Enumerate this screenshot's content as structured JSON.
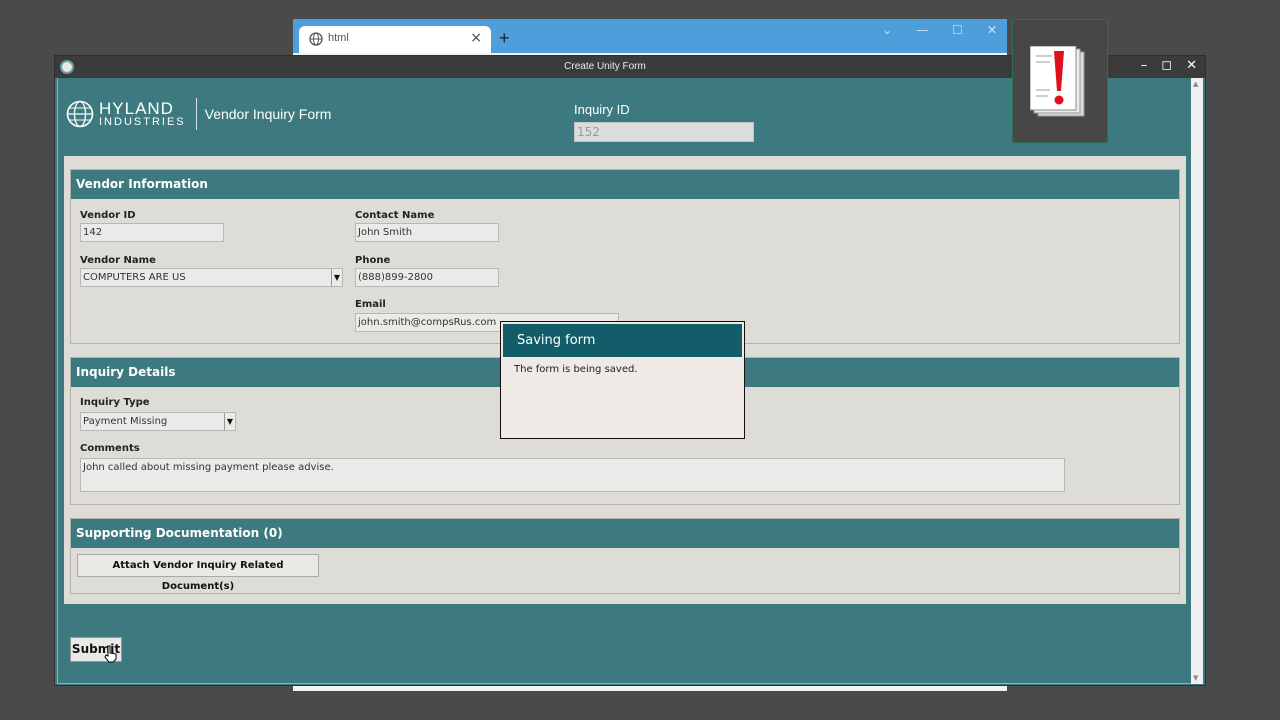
{
  "browser": {
    "tab_title": "html",
    "new_tab_label": "+",
    "close_tab_label": "×",
    "controls": [
      "⌄",
      "—",
      "☐",
      "✕"
    ]
  },
  "window": {
    "title": "Create Unity Form",
    "minimize": "–",
    "maximize": "◻",
    "close": "✕"
  },
  "header": {
    "logo_name": "HYLAND",
    "logo_sub": "INDUSTRIES",
    "form_title": "Vendor Inquiry Form",
    "inquiry_id_label": "Inquiry ID",
    "inquiry_id_value": "152"
  },
  "vendor_info": {
    "heading": "Vendor Information",
    "vendor_id_label": "Vendor ID",
    "vendor_id_value": "142",
    "vendor_name_label": "Vendor Name",
    "vendor_name_value": "COMPUTERS ARE US",
    "contact_name_label": "Contact Name",
    "contact_name_value": "John Smith",
    "phone_label": "Phone",
    "phone_value": "(888)899-2800",
    "email_label": "Email",
    "email_value": "john.smith@compsRus.com"
  },
  "inquiry_details": {
    "heading": "Inquiry Details",
    "type_label": "Inquiry Type",
    "type_value": "Payment Missing",
    "comments_label": "Comments",
    "comments_value": "John called about missing payment please advise."
  },
  "supporting_docs": {
    "heading": "Supporting Documentation (0)",
    "attach_label": "Attach Vendor Inquiry Related Document(s)"
  },
  "submit_label": "Submit",
  "modal": {
    "title": "Saving form",
    "message": "The form is being saved."
  },
  "icons": {
    "dropdown": "▼",
    "scroll_up": "▲",
    "scroll_down": "▼",
    "globe": "globe-icon",
    "alert_document": "alert-document-icon",
    "cursor": "pointer-cursor-icon"
  },
  "colors": {
    "accent_teal": "#3d7a80",
    "modal_header": "#135d6a",
    "browser_blue": "#4f9edc",
    "alert_red": "#e0101c"
  }
}
